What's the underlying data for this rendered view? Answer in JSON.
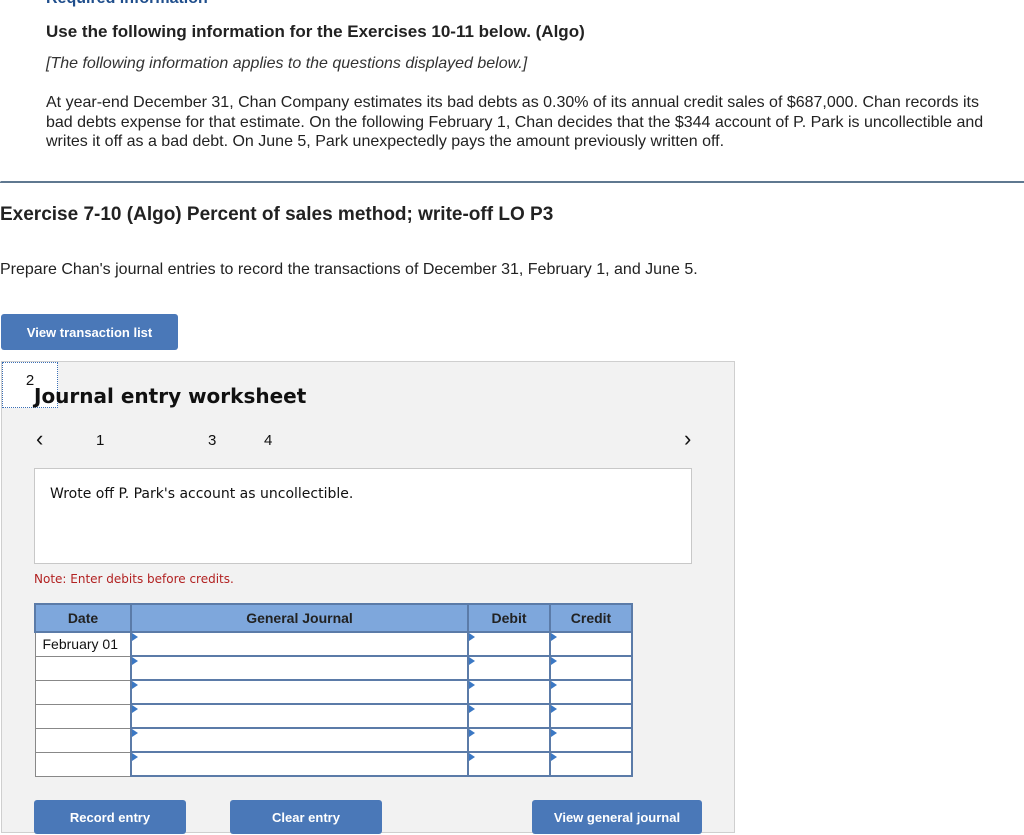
{
  "header": {
    "required_info": "Required information",
    "use_title": "Use the following information for the Exercises 10-11 below. (Algo)",
    "applies_note": "[The following information applies to the questions displayed below.]",
    "paragraph": "At year-end December 31, Chan Company estimates its bad debts as 0.30% of its annual credit sales of $687,000. Chan records its bad debts expense for that estimate. On the following February 1, Chan decides that the $344 account of P. Park is uncollectible and writes it off as a bad debt. On June 5, Park unexpectedly pays the amount previously written off."
  },
  "exercise": {
    "title": "Exercise 7-10 (Algo) Percent of sales method; write-off LO P3",
    "prompt": "Prepare Chan's journal entries to record the transactions of December 31, February 1, and June 5.",
    "view_transaction_list": "View transaction list"
  },
  "worksheet": {
    "title": "Journal entry worksheet",
    "prev_icon": "‹",
    "next_icon": "›",
    "pages": [
      "1",
      "2",
      "3",
      "4"
    ],
    "active_page": "2",
    "description": "Wrote off P. Park's account as uncollectible.",
    "note": "Note: Enter debits before credits.",
    "table": {
      "headers": [
        "Date",
        "General Journal",
        "Debit",
        "Credit"
      ],
      "rows": [
        {
          "date": "February 01",
          "account": "",
          "debit": "",
          "credit": ""
        },
        {
          "date": "",
          "account": "",
          "debit": "",
          "credit": ""
        },
        {
          "date": "",
          "account": "",
          "debit": "",
          "credit": ""
        },
        {
          "date": "",
          "account": "",
          "debit": "",
          "credit": ""
        },
        {
          "date": "",
          "account": "",
          "debit": "",
          "credit": ""
        },
        {
          "date": "",
          "account": "",
          "debit": "",
          "credit": ""
        }
      ]
    },
    "buttons": {
      "record": "Record entry",
      "clear": "Clear entry",
      "view_journal": "View general journal"
    }
  },
  "colors": {
    "button_blue": "#4a78b8",
    "header_blue": "#7ea7dc",
    "note_red": "#b22222"
  }
}
